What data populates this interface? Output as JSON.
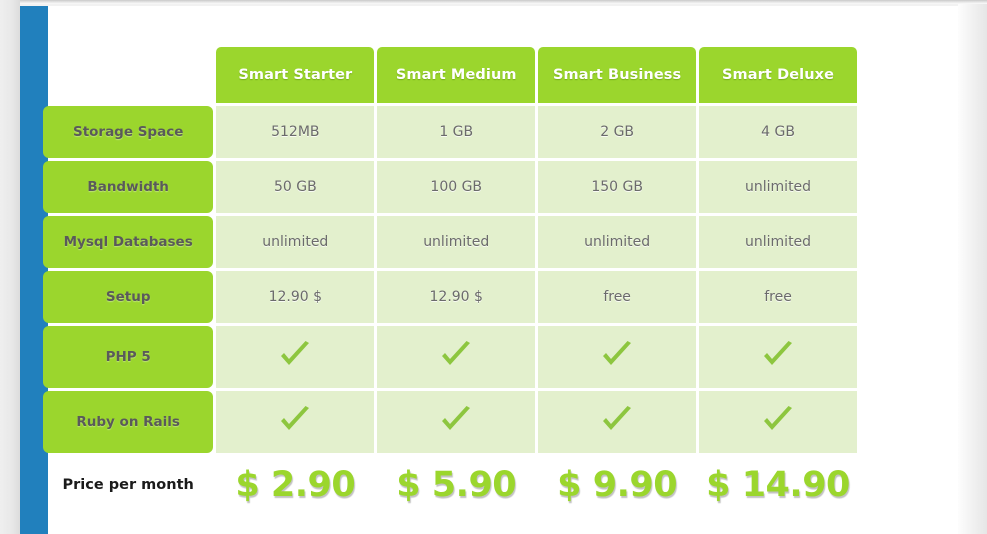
{
  "theme": {
    "header_green": "#9bd62d",
    "cell_green": "#e3f0cd",
    "sidebar_blue": "#2180bd",
    "label_text": "#5a5a5a",
    "value_text": "#6b6b6b",
    "price_green": "#9bd62d"
  },
  "table": {
    "corner_label": "",
    "plans": [
      {
        "name": "Smart Starter"
      },
      {
        "name": "Smart Medium"
      },
      {
        "name": "Smart Business"
      },
      {
        "name": "Smart Deluxe"
      }
    ],
    "rows": [
      {
        "label": "Storage Space",
        "type": "text",
        "values": [
          "512MB",
          "1 GB",
          "2 GB",
          "4 GB"
        ]
      },
      {
        "label": "Bandwidth",
        "type": "text",
        "values": [
          "50 GB",
          "100 GB",
          "150 GB",
          "unlimited"
        ]
      },
      {
        "label": "Mysql Databases",
        "type": "text",
        "values": [
          "unlimited",
          "unlimited",
          "unlimited",
          "unlimited"
        ]
      },
      {
        "label": "Setup",
        "type": "text",
        "values": [
          "12.90 $",
          "12.90 $",
          "free",
          "free"
        ]
      },
      {
        "label": "PHP 5",
        "type": "check",
        "values": [
          "check-icon",
          "check-icon",
          "check-icon",
          "check-icon"
        ]
      },
      {
        "label": "Ruby on Rails",
        "type": "check",
        "values": [
          "check-icon",
          "check-icon",
          "check-icon",
          "check-icon"
        ]
      }
    ],
    "footer": {
      "label": "Price per month",
      "prices": [
        "$ 2.90",
        "$ 5.90",
        "$ 9.90",
        "$ 14.90"
      ]
    }
  }
}
